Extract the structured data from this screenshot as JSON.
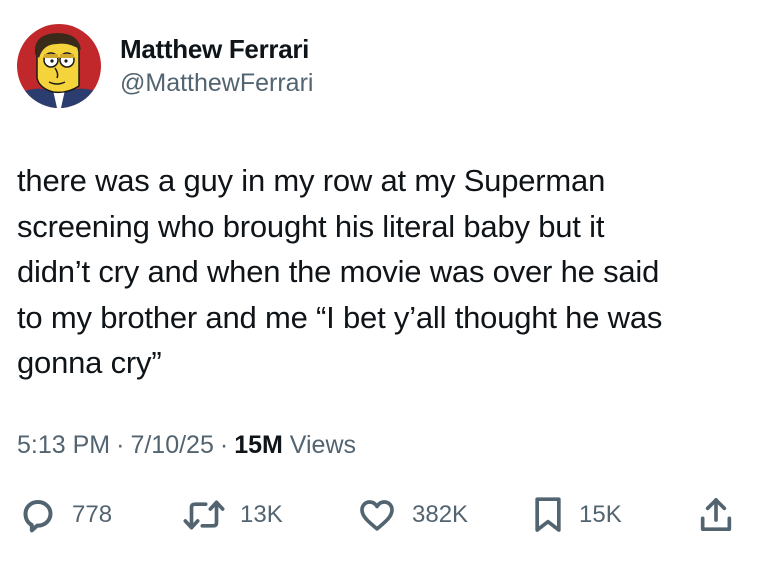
{
  "author": {
    "display_name": "Matthew Ferrari",
    "handle": "@MatthewFerrari"
  },
  "tweet": {
    "lines": [
      "there was a guy in my row at my Superman",
      "screening who brought his literal baby but it",
      "didn’t cry and when the movie was over he said",
      "to my brother and me “I bet y’all thought he was",
      "gonna cry”"
    ]
  },
  "meta": {
    "time": "5:13 PM",
    "separator": "·",
    "date": "7/10/25",
    "views_count": "15M",
    "views_label": "Views"
  },
  "actions": {
    "replies": {
      "icon": "reply-icon",
      "count": "778"
    },
    "retweets": {
      "icon": "retweet-icon",
      "count": "13K"
    },
    "likes": {
      "icon": "heart-icon",
      "count": "382K"
    },
    "bookmarks": {
      "icon": "bookmark-icon",
      "count": "15K"
    },
    "share": {
      "icon": "share-icon"
    }
  },
  "colors": {
    "text": "#0f1419",
    "secondary": "#536471",
    "avatar_background": "#c0282c",
    "avatar_skin": "#f5d33b"
  }
}
